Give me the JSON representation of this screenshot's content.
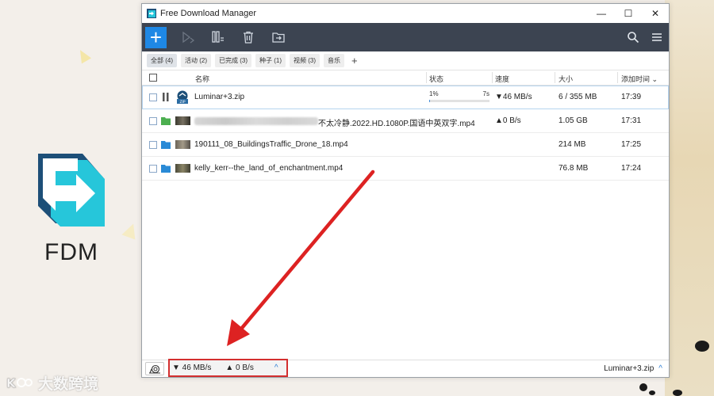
{
  "desktop": {
    "fdm_label": "FDM",
    "watermark_text": "大数跨境",
    "icon": "fdm-logo-icon"
  },
  "window": {
    "title": "Free Download Manager",
    "controls": {
      "minimize": "—",
      "maximize": "☐",
      "close": "✕"
    }
  },
  "toolbar": {
    "add_label": "+",
    "icons": [
      "add-icon",
      "play-icon",
      "pause-icon",
      "trash-icon",
      "move-icon",
      "search-icon",
      "menu-icon"
    ]
  },
  "filters": [
    {
      "label": "全部 (4)",
      "active": true
    },
    {
      "label": "活动 (2)",
      "active": false
    },
    {
      "label": "已完成 (3)",
      "active": false
    },
    {
      "label": "种子 (1)",
      "active": false
    },
    {
      "label": "视频 (3)",
      "active": false
    },
    {
      "label": "音乐",
      "active": false
    }
  ],
  "filter_add": "+",
  "columns": {
    "name": "名称",
    "status": "状态",
    "speed": "速度",
    "size": "大小",
    "added": "添加时间 ⌄"
  },
  "rows": [
    {
      "name": "Luminar+3.zip",
      "status_percent": "1%",
      "status_time": "7s",
      "progress": 0.01,
      "speed": "▼46 MB/s",
      "size": "6 / 355 MB",
      "added": "17:39"
    },
    {
      "name": "不太冷静.2022.HD.1080P.国语中英双字.mp4",
      "speed": "▲0 B/s",
      "size": "1.05 GB",
      "added": "17:31"
    },
    {
      "name": "190111_08_BuildingsTraffic_Drone_18.mp4",
      "speed": "",
      "size": "214 MB",
      "added": "17:25"
    },
    {
      "name": "kelly_kerr--the_land_of_enchantment.mp4",
      "speed": "",
      "size": "76.8 MB",
      "added": "17:24"
    }
  ],
  "statusbar": {
    "download_speed": "▼ 46 MB/s",
    "upload_speed": "▲ 0 B/s",
    "expand": "^",
    "current_file": "Luminar+3.zip",
    "current_expand": "^"
  },
  "colors": {
    "toolbar_bg": "#3c4451",
    "accent": "#1e88e5",
    "annotation_red": "#d32f2f"
  }
}
